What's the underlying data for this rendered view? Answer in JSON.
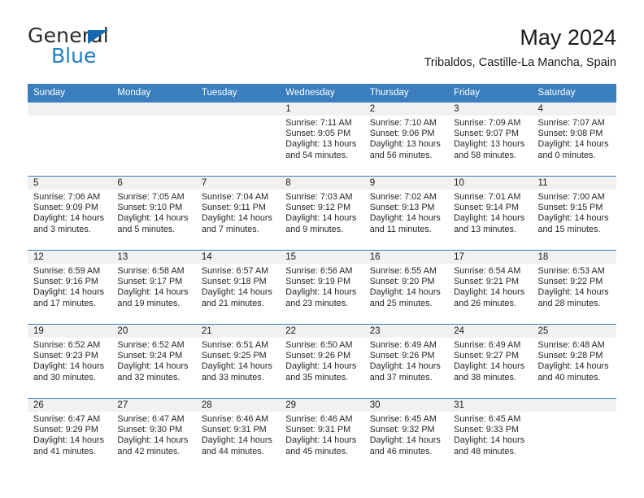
{
  "brand": {
    "name_part1": "General",
    "name_part2": "Blue",
    "logo_icon": "triangle-icon",
    "accent_color": "#1e7fc4",
    "header_color": "#3a7ebd"
  },
  "header": {
    "title": "May 2024",
    "subtitle": "Tribaldos, Castille-La Mancha, Spain"
  },
  "weekdays": [
    "Sunday",
    "Monday",
    "Tuesday",
    "Wednesday",
    "Thursday",
    "Friday",
    "Saturday"
  ],
  "weeks": [
    [
      {
        "day": "",
        "sunrise": "",
        "sunset": "",
        "daylight1": "",
        "daylight2": ""
      },
      {
        "day": "",
        "sunrise": "",
        "sunset": "",
        "daylight1": "",
        "daylight2": ""
      },
      {
        "day": "",
        "sunrise": "",
        "sunset": "",
        "daylight1": "",
        "daylight2": ""
      },
      {
        "day": "1",
        "sunrise": "Sunrise: 7:11 AM",
        "sunset": "Sunset: 9:05 PM",
        "daylight1": "Daylight: 13 hours",
        "daylight2": "and 54 minutes."
      },
      {
        "day": "2",
        "sunrise": "Sunrise: 7:10 AM",
        "sunset": "Sunset: 9:06 PM",
        "daylight1": "Daylight: 13 hours",
        "daylight2": "and 56 minutes."
      },
      {
        "day": "3",
        "sunrise": "Sunrise: 7:09 AM",
        "sunset": "Sunset: 9:07 PM",
        "daylight1": "Daylight: 13 hours",
        "daylight2": "and 58 minutes."
      },
      {
        "day": "4",
        "sunrise": "Sunrise: 7:07 AM",
        "sunset": "Sunset: 9:08 PM",
        "daylight1": "Daylight: 14 hours",
        "daylight2": "and 0 minutes."
      }
    ],
    [
      {
        "day": "5",
        "sunrise": "Sunrise: 7:06 AM",
        "sunset": "Sunset: 9:09 PM",
        "daylight1": "Daylight: 14 hours",
        "daylight2": "and 3 minutes."
      },
      {
        "day": "6",
        "sunrise": "Sunrise: 7:05 AM",
        "sunset": "Sunset: 9:10 PM",
        "daylight1": "Daylight: 14 hours",
        "daylight2": "and 5 minutes."
      },
      {
        "day": "7",
        "sunrise": "Sunrise: 7:04 AM",
        "sunset": "Sunset: 9:11 PM",
        "daylight1": "Daylight: 14 hours",
        "daylight2": "and 7 minutes."
      },
      {
        "day": "8",
        "sunrise": "Sunrise: 7:03 AM",
        "sunset": "Sunset: 9:12 PM",
        "daylight1": "Daylight: 14 hours",
        "daylight2": "and 9 minutes."
      },
      {
        "day": "9",
        "sunrise": "Sunrise: 7:02 AM",
        "sunset": "Sunset: 9:13 PM",
        "daylight1": "Daylight: 14 hours",
        "daylight2": "and 11 minutes."
      },
      {
        "day": "10",
        "sunrise": "Sunrise: 7:01 AM",
        "sunset": "Sunset: 9:14 PM",
        "daylight1": "Daylight: 14 hours",
        "daylight2": "and 13 minutes."
      },
      {
        "day": "11",
        "sunrise": "Sunrise: 7:00 AM",
        "sunset": "Sunset: 9:15 PM",
        "daylight1": "Daylight: 14 hours",
        "daylight2": "and 15 minutes."
      }
    ],
    [
      {
        "day": "12",
        "sunrise": "Sunrise: 6:59 AM",
        "sunset": "Sunset: 9:16 PM",
        "daylight1": "Daylight: 14 hours",
        "daylight2": "and 17 minutes."
      },
      {
        "day": "13",
        "sunrise": "Sunrise: 6:58 AM",
        "sunset": "Sunset: 9:17 PM",
        "daylight1": "Daylight: 14 hours",
        "daylight2": "and 19 minutes."
      },
      {
        "day": "14",
        "sunrise": "Sunrise: 6:57 AM",
        "sunset": "Sunset: 9:18 PM",
        "daylight1": "Daylight: 14 hours",
        "daylight2": "and 21 minutes."
      },
      {
        "day": "15",
        "sunrise": "Sunrise: 6:56 AM",
        "sunset": "Sunset: 9:19 PM",
        "daylight1": "Daylight: 14 hours",
        "daylight2": "and 23 minutes."
      },
      {
        "day": "16",
        "sunrise": "Sunrise: 6:55 AM",
        "sunset": "Sunset: 9:20 PM",
        "daylight1": "Daylight: 14 hours",
        "daylight2": "and 25 minutes."
      },
      {
        "day": "17",
        "sunrise": "Sunrise: 6:54 AM",
        "sunset": "Sunset: 9:21 PM",
        "daylight1": "Daylight: 14 hours",
        "daylight2": "and 26 minutes."
      },
      {
        "day": "18",
        "sunrise": "Sunrise: 6:53 AM",
        "sunset": "Sunset: 9:22 PM",
        "daylight1": "Daylight: 14 hours",
        "daylight2": "and 28 minutes."
      }
    ],
    [
      {
        "day": "19",
        "sunrise": "Sunrise: 6:52 AM",
        "sunset": "Sunset: 9:23 PM",
        "daylight1": "Daylight: 14 hours",
        "daylight2": "and 30 minutes."
      },
      {
        "day": "20",
        "sunrise": "Sunrise: 6:52 AM",
        "sunset": "Sunset: 9:24 PM",
        "daylight1": "Daylight: 14 hours",
        "daylight2": "and 32 minutes."
      },
      {
        "day": "21",
        "sunrise": "Sunrise: 6:51 AM",
        "sunset": "Sunset: 9:25 PM",
        "daylight1": "Daylight: 14 hours",
        "daylight2": "and 33 minutes."
      },
      {
        "day": "22",
        "sunrise": "Sunrise: 6:50 AM",
        "sunset": "Sunset: 9:26 PM",
        "daylight1": "Daylight: 14 hours",
        "daylight2": "and 35 minutes."
      },
      {
        "day": "23",
        "sunrise": "Sunrise: 6:49 AM",
        "sunset": "Sunset: 9:26 PM",
        "daylight1": "Daylight: 14 hours",
        "daylight2": "and 37 minutes."
      },
      {
        "day": "24",
        "sunrise": "Sunrise: 6:49 AM",
        "sunset": "Sunset: 9:27 PM",
        "daylight1": "Daylight: 14 hours",
        "daylight2": "and 38 minutes."
      },
      {
        "day": "25",
        "sunrise": "Sunrise: 6:48 AM",
        "sunset": "Sunset: 9:28 PM",
        "daylight1": "Daylight: 14 hours",
        "daylight2": "and 40 minutes."
      }
    ],
    [
      {
        "day": "26",
        "sunrise": "Sunrise: 6:47 AM",
        "sunset": "Sunset: 9:29 PM",
        "daylight1": "Daylight: 14 hours",
        "daylight2": "and 41 minutes."
      },
      {
        "day": "27",
        "sunrise": "Sunrise: 6:47 AM",
        "sunset": "Sunset: 9:30 PM",
        "daylight1": "Daylight: 14 hours",
        "daylight2": "and 42 minutes."
      },
      {
        "day": "28",
        "sunrise": "Sunrise: 6:46 AM",
        "sunset": "Sunset: 9:31 PM",
        "daylight1": "Daylight: 14 hours",
        "daylight2": "and 44 minutes."
      },
      {
        "day": "29",
        "sunrise": "Sunrise: 6:46 AM",
        "sunset": "Sunset: 9:31 PM",
        "daylight1": "Daylight: 14 hours",
        "daylight2": "and 45 minutes."
      },
      {
        "day": "30",
        "sunrise": "Sunrise: 6:45 AM",
        "sunset": "Sunset: 9:32 PM",
        "daylight1": "Daylight: 14 hours",
        "daylight2": "and 46 minutes."
      },
      {
        "day": "31",
        "sunrise": "Sunrise: 6:45 AM",
        "sunset": "Sunset: 9:33 PM",
        "daylight1": "Daylight: 14 hours",
        "daylight2": "and 48 minutes."
      },
      {
        "day": "",
        "sunrise": "",
        "sunset": "",
        "daylight1": "",
        "daylight2": ""
      }
    ]
  ]
}
